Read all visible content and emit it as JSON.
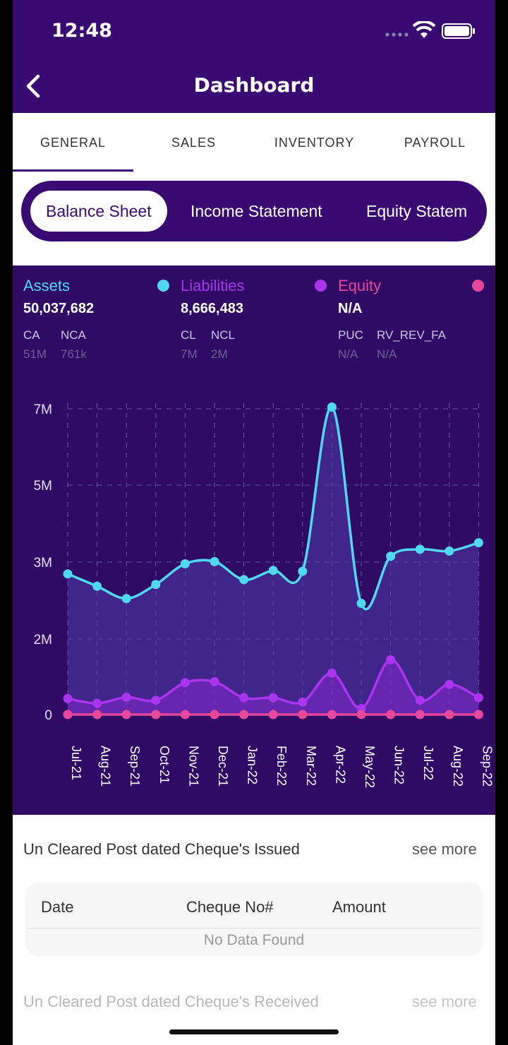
{
  "status": {
    "time": "12:48"
  },
  "header": {
    "title": "Dashboard"
  },
  "tabs": [
    {
      "label": "GENERAL",
      "active": true
    },
    {
      "label": "SALES"
    },
    {
      "label": "INVENTORY"
    },
    {
      "label": "PAYROLL"
    }
  ],
  "segments": [
    {
      "label": "Balance Sheet",
      "active": true
    },
    {
      "label": "Income Statement"
    },
    {
      "label": "Equity Statem"
    }
  ],
  "summary": {
    "assets": {
      "name": "Assets",
      "total": "50,037,682",
      "sub": [
        {
          "label": "CA",
          "value": "51M"
        },
        {
          "label": "NCA",
          "value": "761k"
        }
      ]
    },
    "liabilities": {
      "name": "Liabilities",
      "total": "8,666,483",
      "sub": [
        {
          "label": "CL",
          "value": "7M"
        },
        {
          "label": "NCL",
          "value": "2M"
        }
      ]
    },
    "equity": {
      "name": "Equity",
      "total": "N/A",
      "sub": [
        {
          "label": "PUC",
          "value": "N/A"
        },
        {
          "label": "RV_REV_FA",
          "value": "N/A"
        }
      ]
    }
  },
  "colors": {
    "header": "#3a0a73",
    "panel": "#2f0b66",
    "assets": "#4fd8f0",
    "liabilities": "#a935ee",
    "equity": "#e8489a"
  },
  "chart_data": {
    "type": "area",
    "categories": [
      "Jul-21",
      "Aug-21",
      "Sep-21",
      "Oct-21",
      "Nov-21",
      "Dec-21",
      "Jan-22",
      "Feb-22",
      "Mar-22",
      "Apr-22",
      "May-22",
      "Jun-22",
      "Jul-22",
      "Aug-22",
      "Sep-22"
    ],
    "y_ticks": [
      "0",
      "2M",
      "3M",
      "5M",
      "7M"
    ],
    "grid": true,
    "series": [
      {
        "name": "Assets",
        "values": [
          3230000,
          2950000,
          2670000,
          2990000,
          3460000,
          3510000,
          3100000,
          3310000,
          3290000,
          7040000,
          2560000,
          3630000,
          3790000,
          3750000,
          3940000
        ]
      },
      {
        "name": "Liabilities",
        "values": [
          370000,
          260000,
          400000,
          330000,
          740000,
          760000,
          390000,
          390000,
          290000,
          960000,
          140000,
          1270000,
          330000,
          700000,
          390000
        ]
      },
      {
        "name": "Equity",
        "values": [
          0,
          0,
          0,
          0,
          0,
          0,
          0,
          0,
          0,
          0,
          0,
          0,
          0,
          0,
          0
        ]
      }
    ]
  },
  "section1": {
    "title": "Un Cleared Post dated Cheque's Issued",
    "see_more": "see more",
    "columns": [
      "Date",
      "Cheque No#",
      "Amount"
    ],
    "empty": "No Data Found"
  },
  "section2": {
    "title": "Un Cleared Post dated Cheque's Received",
    "see_more": "see more"
  }
}
